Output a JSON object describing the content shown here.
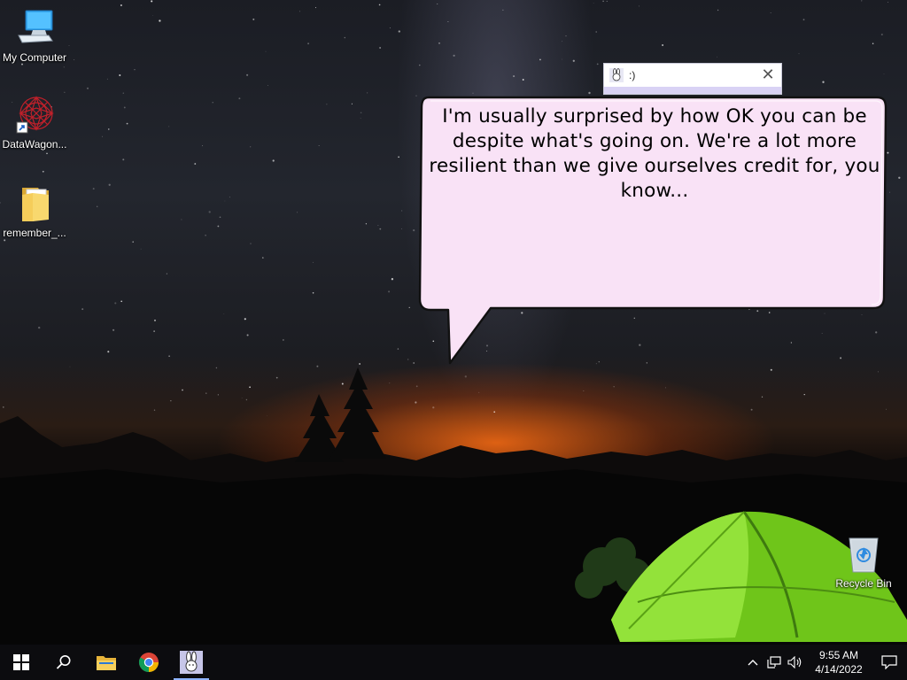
{
  "desktop": {
    "icons": [
      {
        "label": "My Computer",
        "icon": "monitor-icon"
      },
      {
        "label": "DataWagon...",
        "icon": "datawagon-icon"
      },
      {
        "label": "remember_...",
        "icon": "folder-icon"
      },
      {
        "label": "Recycle Bin",
        "icon": "recycle-bin-icon"
      }
    ]
  },
  "mini_window": {
    "title": ":)",
    "close_glyph": "✕"
  },
  "speech_bubble": {
    "text": "I'm usually surprised by how OK you can be despite what's going on. We're a lot more resilient than we give ourselves credit for, you know..."
  },
  "taskbar": {
    "items": [
      {
        "name": "start-button",
        "icon": "windows-logo-icon"
      },
      {
        "name": "search-button",
        "icon": "search-icon"
      },
      {
        "name": "file-explorer-button",
        "icon": "folder-icon"
      },
      {
        "name": "chrome-button",
        "icon": "chrome-icon"
      },
      {
        "name": "character-app-button",
        "icon": "bunny-icon",
        "active": true
      }
    ],
    "tray": {
      "time": "9:55 AM",
      "date": "4/14/2022"
    }
  },
  "colors": {
    "bubble_fill": "#f9e2f6",
    "bubble_border": "#111111",
    "taskbar_bg": "#0c0c0f",
    "active_indicator": "#8fb4ff",
    "tent_green": "#7ed321"
  }
}
